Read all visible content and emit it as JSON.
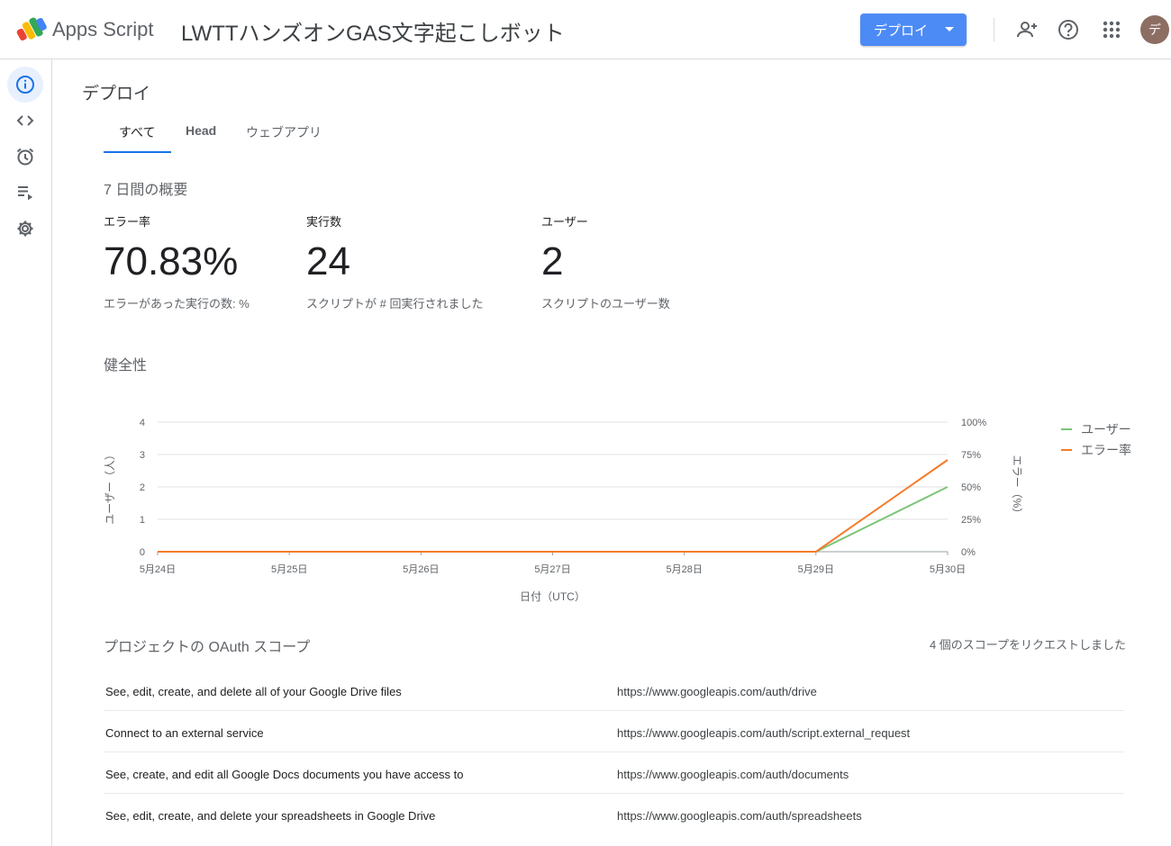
{
  "header": {
    "app_name": "Apps Script",
    "project_title": "LWTTハンズオンGAS文字起こしボット",
    "deploy_label": "デプロイ",
    "avatar_initial": "デ"
  },
  "sidebar": {
    "items": [
      {
        "name": "overview",
        "icon": "info-icon"
      },
      {
        "name": "editor",
        "icon": "code-icon"
      },
      {
        "name": "triggers",
        "icon": "alarm-clock-icon"
      },
      {
        "name": "executions",
        "icon": "playlist-icon"
      },
      {
        "name": "settings",
        "icon": "gear-icon"
      }
    ]
  },
  "main": {
    "title": "デプロイ",
    "tabs": [
      {
        "label": "すべて",
        "active": true
      },
      {
        "label": "Head",
        "active": false
      },
      {
        "label": "ウェブアプリ",
        "active": false
      }
    ],
    "summary_title": "7 日間の概要",
    "stats": [
      {
        "label": "エラー率",
        "value": "70.83%",
        "desc": "エラーがあった実行の数: %"
      },
      {
        "label": "実行数",
        "value": "24",
        "desc": "スクリプトが # 回実行されました"
      },
      {
        "label": "ユーザー",
        "value": "2",
        "desc": "スクリプトのユーザー数"
      }
    ],
    "health_title": "健全性",
    "scopes_title": "プロジェクトの OAuth スコープ",
    "scopes_count": "4 個のスコープをリクエストしました",
    "scopes": [
      {
        "desc": "See, edit, create, and delete all of your Google Drive files",
        "url": "https://www.googleapis.com/auth/drive"
      },
      {
        "desc": "Connect to an external service",
        "url": "https://www.googleapis.com/auth/script.external_request"
      },
      {
        "desc": "See, create, and edit all Google Docs documents you have access to",
        "url": "https://www.googleapis.com/auth/documents"
      },
      {
        "desc": "See, edit, create, and delete your spreadsheets in Google Drive",
        "url": "https://www.googleapis.com/auth/spreadsheets"
      }
    ]
  },
  "chart_data": {
    "type": "line",
    "xlabel": "日付（UTC）",
    "ylabel_left": "ユーザー（人）",
    "ylabel_right": "エラー（%）",
    "categories": [
      "5月24日",
      "5月25日",
      "5月26日",
      "5月27日",
      "5月28日",
      "5月29日",
      "5月30日"
    ],
    "y_left_ticks": [
      "0",
      "1",
      "2",
      "3",
      "4"
    ],
    "y_right_ticks": [
      "0%",
      "25%",
      "50%",
      "75%",
      "100%"
    ],
    "ylim_left": [
      0,
      4
    ],
    "ylim_right": [
      0,
      100
    ],
    "grid": true,
    "legend_position": "right",
    "series": [
      {
        "name": "ユーザー",
        "axis": "left",
        "color": "#7cc576",
        "values": [
          0,
          0,
          0,
          0,
          0,
          0,
          2
        ]
      },
      {
        "name": "エラー率",
        "axis": "right",
        "color": "#f57c2b",
        "values": [
          0,
          0,
          0,
          0,
          0,
          0,
          70.83
        ]
      }
    ]
  }
}
